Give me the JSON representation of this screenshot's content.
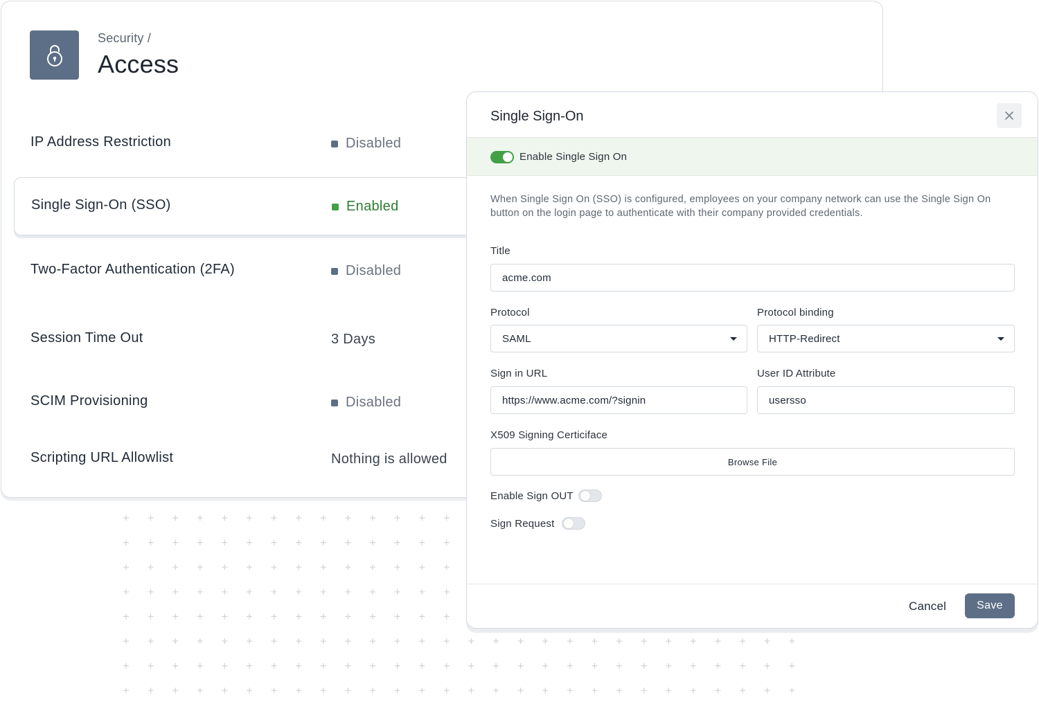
{
  "header": {
    "breadcrumb": "Security /",
    "title": "Access",
    "icon": "lock-icon",
    "icon_bg": "#5c6f86"
  },
  "settings": [
    {
      "label": "IP Address Restriction",
      "value": "Disabled",
      "status": "disabled"
    },
    {
      "label": "Single Sign-On (SSO)",
      "value": "Enabled",
      "status": "enabled"
    },
    {
      "label": "Two-Factor Authentication (2FA)",
      "value": "Disabled",
      "status": "disabled"
    },
    {
      "label": "Session Time Out",
      "value": "3 Days",
      "status": "none"
    },
    {
      "label": "SCIM Provisioning",
      "value": "Disabled",
      "status": "disabled"
    },
    {
      "label": "Scripting URL Allowlist",
      "value": "Nothing is allowed",
      "status": "none"
    }
  ],
  "status_colors": {
    "enabled": "#43a047",
    "disabled": "#5c6f86"
  },
  "modal": {
    "title": "Single Sign-On",
    "close_icon": "close-icon",
    "enable_sso": {
      "label": "Enable Single Sign On",
      "on": true
    },
    "description": "When Single Sign On (SSO) is configured, employees on your company network can use the Single Sign On button on the login page to authenticate with their company provided credentials.",
    "fields": {
      "title": {
        "label": "Title",
        "value": "acme.com"
      },
      "protocol": {
        "label": "Protocol",
        "value": "SAML"
      },
      "protocol_binding": {
        "label": "Protocol binding",
        "value": "HTTP-Redirect"
      },
      "sign_in_url": {
        "label": "Sign in URL",
        "value": "https://www.acme.com/?signin"
      },
      "user_id_attribute": {
        "label": "User ID Attribute",
        "value": "usersso"
      },
      "certificate": {
        "label": "X509 Signing Certiciface",
        "button": "Browse File"
      }
    },
    "enable_sign_out": {
      "label": "Enable Sign OUT",
      "on": false
    },
    "sign_request": {
      "label": "Sign Request",
      "on": false
    },
    "footer": {
      "cancel": "Cancel",
      "save": "Save"
    },
    "accent": "#43a047",
    "primary": "#5c6f86"
  }
}
